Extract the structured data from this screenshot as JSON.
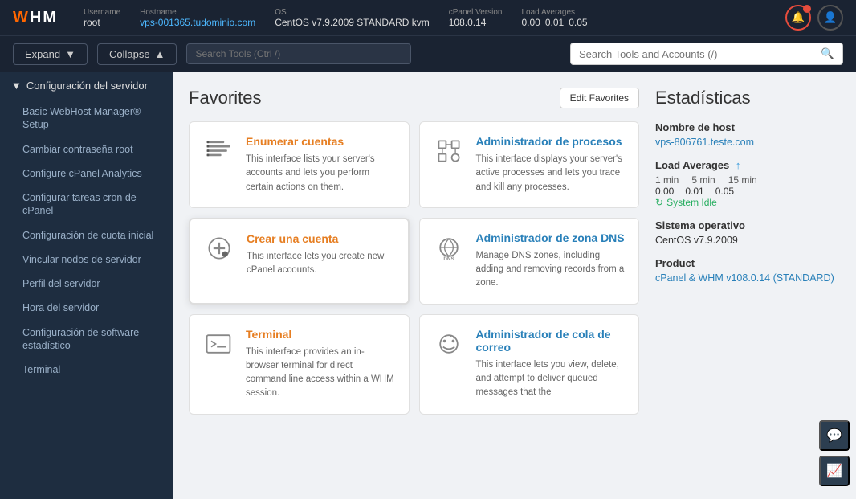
{
  "topbar": {
    "logo": "WHM",
    "username_label": "Username",
    "username_value": "root",
    "hostname_label": "Hostname",
    "hostname_value": "vps-001365.tudominio.com",
    "os_label": "OS",
    "os_value": "CentOS v7.9.2009 STANDARD kvm",
    "cpanel_version_label": "cPanel Version",
    "cpanel_version_value": "108.0.14",
    "load_averages_label": "Load Averages",
    "load_avg_1": "0.00",
    "load_avg_2": "0.01",
    "load_avg_3": "0.05"
  },
  "secbar": {
    "expand_label": "Expand",
    "collapse_label": "Collapse",
    "search_placeholder": "Search Tools (Ctrl /)",
    "main_search_placeholder": "Search Tools and Accounts (/)"
  },
  "sidebar": {
    "section_label": "Configuración del servidor",
    "items": [
      "Basic WebHost Manager® Setup",
      "Cambiar contraseña root",
      "Configure cPanel Analytics",
      "Configurar tareas cron de cPanel",
      "Configuración de cuota inicial",
      "Vincular nodos de servidor",
      "Perfil del servidor",
      "Hora del servidor",
      "Configuración de software estadístico",
      "Terminal"
    ]
  },
  "favorites": {
    "section_title": "Favorites",
    "edit_btn_label": "Edit Favorites",
    "cards": [
      {
        "id": "enumerar-cuentas",
        "title": "Enumerar cuentas",
        "title_color": "orange",
        "description": "This interface lists your server's accounts and lets you perform certain actions on them.",
        "icon": "list"
      },
      {
        "id": "administrador-procesos",
        "title": "Administrador de procesos",
        "title_color": "blue",
        "description": "This interface displays your server's active processes and lets you trace and kill any processes.",
        "icon": "processes"
      },
      {
        "id": "crear-cuenta",
        "title": "Crear una cuenta",
        "title_color": "orange",
        "description": "This interface lets you create new cPanel accounts.",
        "icon": "add"
      },
      {
        "id": "administrador-dns",
        "title": "Administrador de zona DNS",
        "title_color": "blue",
        "description": "Manage DNS zones, including adding and removing records from a zone.",
        "icon": "dns"
      },
      {
        "id": "terminal",
        "title": "Terminal",
        "title_color": "orange",
        "description": "This interface provides an in-browser terminal for direct command line access within a WHM session.",
        "icon": "terminal"
      },
      {
        "id": "administrador-cola-correo",
        "title": "Administrador de cola de correo",
        "title_color": "blue",
        "description": "This interface lets you view, delete, and attempt to deliver queued messages that the",
        "icon": "mail"
      }
    ]
  },
  "stats": {
    "section_title": "Estadísticas",
    "hostname_label": "Nombre de host",
    "hostname_value": "vps-806761.teste.com",
    "load_avg_label": "Load Averages",
    "load_avg_mins": [
      "1 min",
      "5 min",
      "15 min"
    ],
    "load_avg_vals": [
      "0.00",
      "0.01",
      "0.05"
    ],
    "system_idle_label": "System Idle",
    "os_label": "Sistema operativo",
    "os_value": "CentOS v7.9.2009",
    "product_label": "Product",
    "product_value": "cPanel & WHM v108.0.14 (STANDARD)"
  }
}
